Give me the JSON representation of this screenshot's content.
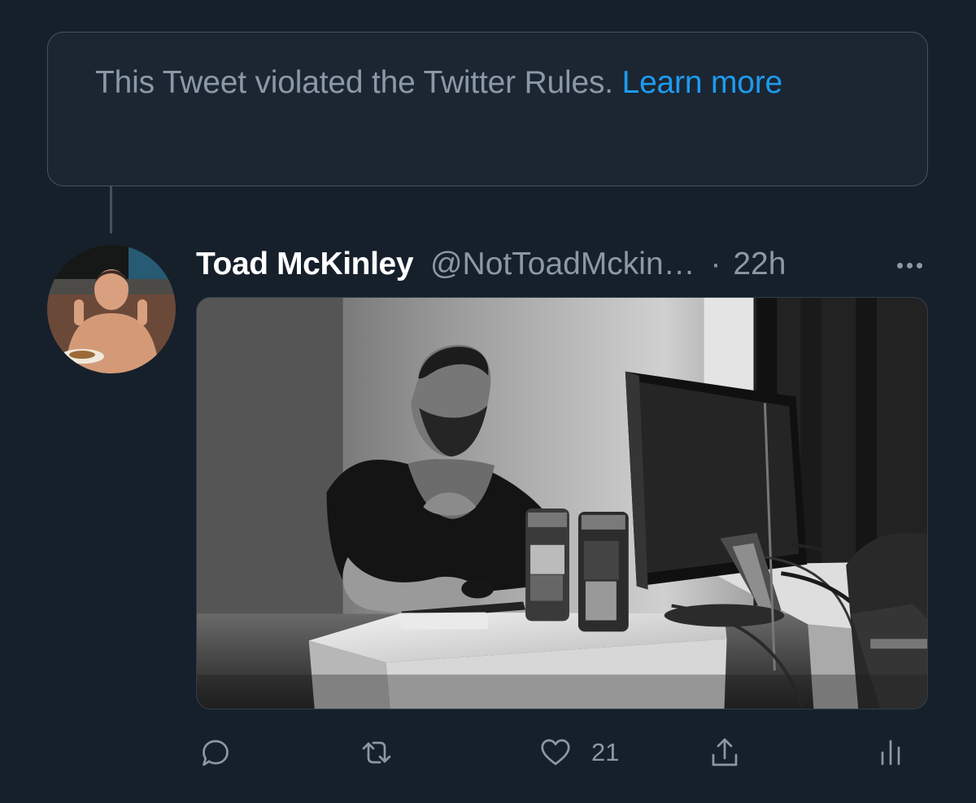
{
  "violation_notice": {
    "message": "This Tweet violated the Twitter Rules.",
    "link_label": "Learn more"
  },
  "tweet": {
    "display_name": "Toad McKinley",
    "handle": "@NotToadMckin…",
    "separator": "·",
    "timestamp": "22h",
    "more_icon": "more-horizontal-icon",
    "media_alt": "Black-and-white photo of a bearded man sitting at a computer desk with two cans beside the monitor",
    "actions": {
      "reply_icon": "reply-icon",
      "retweet_icon": "retweet-icon",
      "like_icon": "heart-icon",
      "like_count": "21",
      "share_icon": "share-icon",
      "analytics_icon": "analytics-icon"
    }
  },
  "colors": {
    "background": "#16202b",
    "secondary_text": "#8b98a5",
    "link": "#1d9bf0",
    "border": "#445362"
  }
}
